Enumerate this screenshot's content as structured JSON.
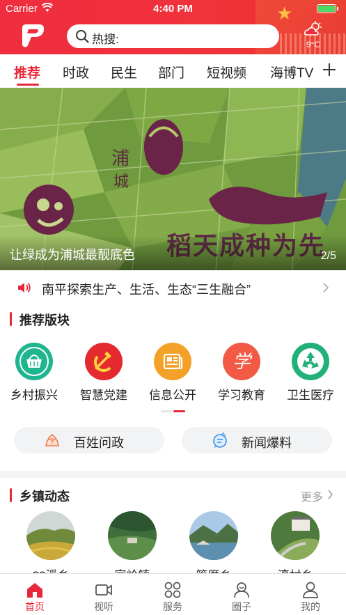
{
  "status_bar": {
    "carrier": "Carrier",
    "time": "4:40 PM"
  },
  "header": {
    "search_placeholder": "热搜:",
    "weather_temp": "9°C",
    "brand_color": "#ef2d3f"
  },
  "tabs": [
    {
      "label": "推荐",
      "active": true
    },
    {
      "label": "时政"
    },
    {
      "label": "民生"
    },
    {
      "label": "部门"
    },
    {
      "label": "短视频"
    },
    {
      "label": "海博TV"
    }
  ],
  "banner": {
    "caption": "让绿成为浦城最靓底色",
    "index": "2/5",
    "art_text": "稻天成种为先"
  },
  "notice": {
    "text": "南平探索生产、生活、生态“三生融合”"
  },
  "recommend": {
    "title": "推荐版块",
    "items": [
      {
        "label": "乡村振兴",
        "icon": "basket-icon",
        "color": "#1fb58e"
      },
      {
        "label": "智慧党建",
        "icon": "hammer-sickle-icon",
        "color": "#e42a2f"
      },
      {
        "label": "信息公开",
        "icon": "newspaper-icon",
        "color": "#f4a12a"
      },
      {
        "label": "学习教育",
        "icon": "study-icon",
        "color": "#f25a45"
      },
      {
        "label": "卫生医疗",
        "icon": "recycle-icon",
        "color": "#22b07a"
      }
    ],
    "quick": [
      {
        "label": "百姓问政",
        "icon": "question-icon"
      },
      {
        "label": "新闻爆料",
        "icon": "chat-bubble-icon"
      }
    ]
  },
  "towns": {
    "title": "乡镇动态",
    "more": "更多",
    "items": [
      {
        "name": "??溪乡"
      },
      {
        "name": "富岭镇"
      },
      {
        "name": "管厝乡"
      },
      {
        "name": "濠村乡"
      }
    ]
  },
  "bottom_nav": [
    {
      "label": "首页",
      "active": true
    },
    {
      "label": "视听"
    },
    {
      "label": "服务"
    },
    {
      "label": "圈子"
    },
    {
      "label": "我的"
    }
  ]
}
